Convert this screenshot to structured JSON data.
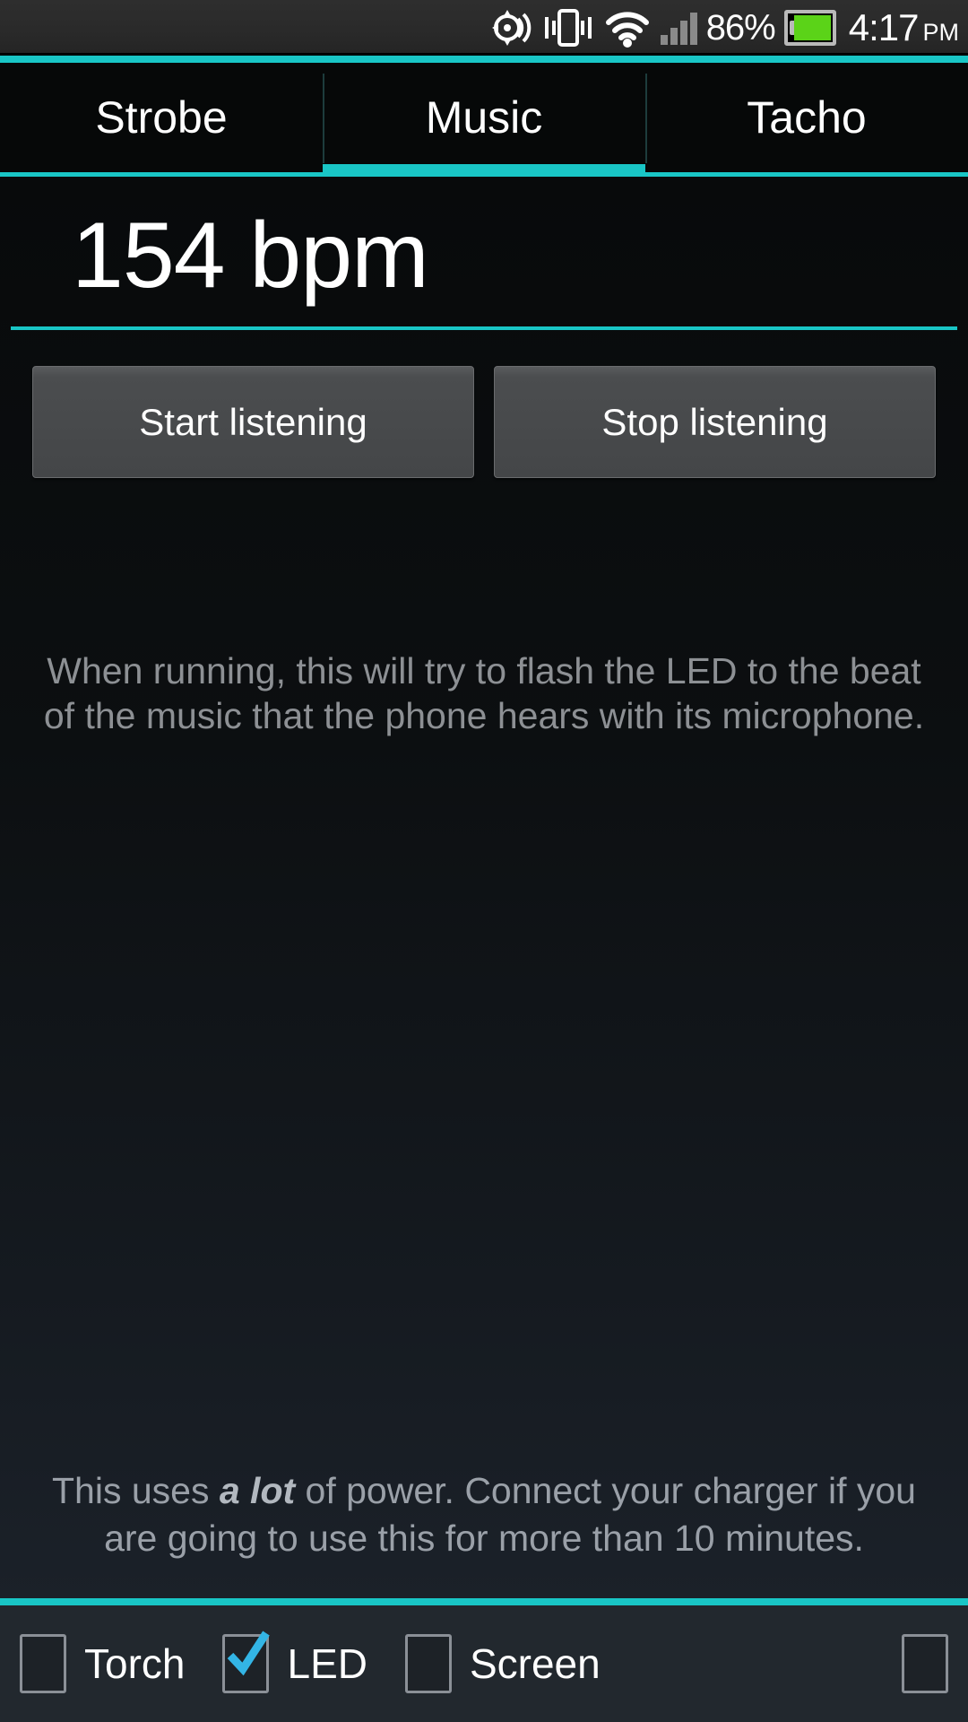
{
  "statusbar": {
    "icons": [
      "gps-icon",
      "vibrate-icon",
      "wifi-icon",
      "signal-icon"
    ],
    "battery_percent": "86%",
    "battery_level": 86,
    "battery_color": "#5bd318",
    "time": "4:17",
    "ampm": "PM"
  },
  "tabs": {
    "items": [
      {
        "label": "Strobe",
        "active": false
      },
      {
        "label": "Music",
        "active": true
      },
      {
        "label": "Tacho",
        "active": false
      }
    ],
    "accent_color": "#19c6c6"
  },
  "main": {
    "bpm_value": "154 bpm",
    "buttons": {
      "start_label": "Start listening",
      "stop_label": "Stop listening"
    },
    "description": "When running, this will try to flash the LED to the beat of the music that the phone hears with its microphone.",
    "power_note": {
      "part1": "This uses ",
      "emphasis": "a lot",
      "part2": " of power. Connect your charger if you are going to use this for more than 10 minutes."
    }
  },
  "bottombar": {
    "checkboxes": [
      {
        "label": "Torch",
        "checked": false
      },
      {
        "label": "LED",
        "checked": true
      },
      {
        "label": "Screen",
        "checked": false
      },
      {
        "label": "",
        "checked": false
      }
    ],
    "check_color": "#33b5e5"
  }
}
